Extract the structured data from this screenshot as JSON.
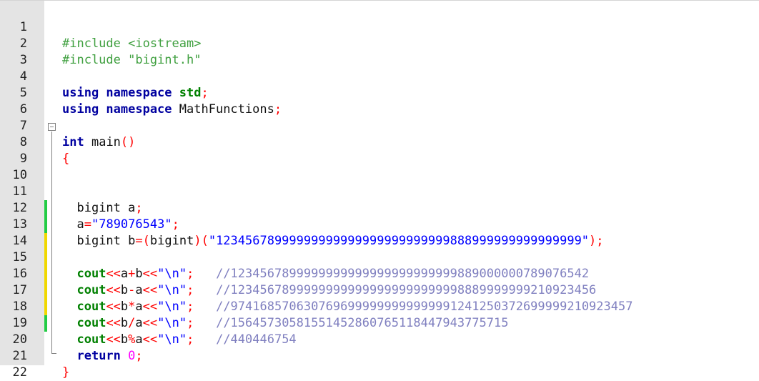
{
  "line_numbers": [
    "1",
    "2",
    "3",
    "4",
    "5",
    "6",
    "7",
    "8",
    "9",
    "10",
    "11",
    "12",
    "13",
    "14",
    "15",
    "16",
    "17",
    "18",
    "19",
    "20",
    "21",
    "22"
  ],
  "colors": {
    "gutter_bg": "#e4e4e4",
    "change_saved": "#22cc44",
    "change_unsaved": "#f0d800"
  },
  "code": {
    "l1": {
      "text": "#include <iostream>"
    },
    "l2": {
      "text": "#include \"bigint.h\""
    },
    "l4": {
      "kw": "using namespace",
      "ns": "std",
      "semi": ";"
    },
    "l5": {
      "kw": "using namespace",
      "ns": "MathFunctions",
      "semi": ";"
    },
    "l7": {
      "kw": "int",
      "name": "main",
      "paren": "()"
    },
    "l8": {
      "brace": "{"
    },
    "l11": {
      "type": "bigint",
      "var": "a",
      "semi": ";"
    },
    "l12": {
      "var": "a",
      "eq": "=",
      "str": "\"789076543\"",
      "semi": ";"
    },
    "l13": {
      "type": "bigint",
      "var": "b",
      "eq": "=",
      "lp": "(",
      "cast": "bigint",
      "rp": ")",
      "lp2": "(",
      "str": "\"12345678999999999999999999999999888999999999999999\"",
      "end": ");"
    },
    "l15": {
      "cout": "cout",
      "op1": "<<",
      "a": "a",
      "op": "+",
      "b": "b",
      "op2": "<<",
      "str": "\"\\n\"",
      "semi": ";",
      "comment": "//1234567899999999999999999999999889000000789076542"
    },
    "l16": {
      "cout": "cout",
      "op1": "<<",
      "a": "b",
      "op": "-",
      "b": "a",
      "op2": "<<",
      "str": "\"\\n\"",
      "semi": ";",
      "comment": "//12345678999999999999999999999998889999999210923456"
    },
    "l17": {
      "cout": "cout",
      "op1": "<<",
      "a": "b",
      "op": "*",
      "b": "a",
      "op2": "<<",
      "str": "\"\\n\"",
      "semi": ";",
      "comment": "//9741685706307696999999999999991241250372699999210923457"
    },
    "l18": {
      "cout": "cout",
      "op1": "<<",
      "a": "b",
      "op": "/",
      "b": "a",
      "op2": "<<",
      "str": "\"\\n\"",
      "semi": ";",
      "comment": "//15645730581551452860765118447943775715"
    },
    "l19": {
      "cout": "cout",
      "op1": "<<",
      "a": "b",
      "op": "%",
      "b": "a",
      "op2": "<<",
      "str": "\"\\n\"",
      "semi": ";",
      "comment": "//440446754"
    },
    "l20": {
      "kw": "return",
      "num": "0",
      "semi": ";"
    },
    "l21": {
      "brace": "}"
    }
  }
}
